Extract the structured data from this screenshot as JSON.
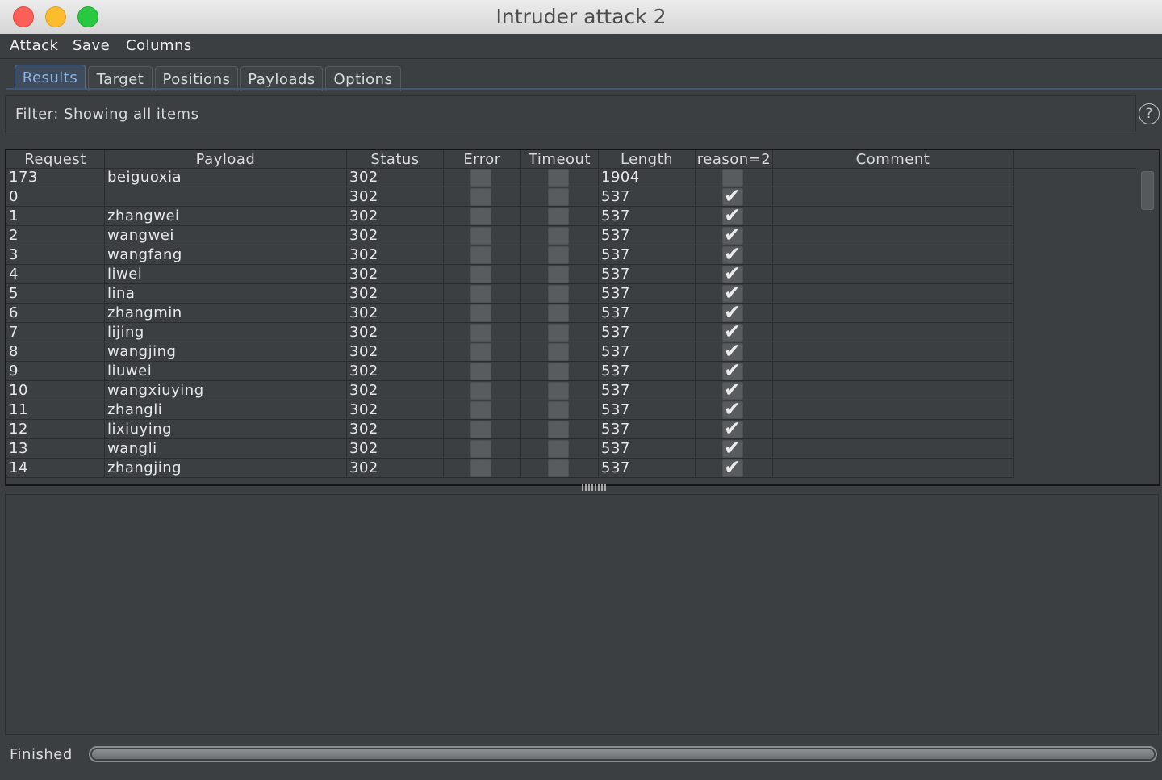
{
  "window": {
    "title": "Intruder attack 2"
  },
  "menu": [
    "Attack",
    "Save",
    "Columns"
  ],
  "tabs": [
    {
      "label": "Results",
      "active": true
    },
    {
      "label": "Target",
      "active": false
    },
    {
      "label": "Positions",
      "active": false
    },
    {
      "label": "Payloads",
      "active": false
    },
    {
      "label": "Options",
      "active": false
    }
  ],
  "filter": {
    "text": "Filter: Showing all items"
  },
  "help_icon_glyph": "?",
  "table": {
    "columns": [
      "Request",
      "Payload",
      "Status",
      "Error",
      "Timeout",
      "Length",
      "reason=2",
      "Comment"
    ],
    "rows": [
      {
        "request": "173",
        "payload": "beiguoxia",
        "status": "302",
        "error": false,
        "timeout": false,
        "length": "1904",
        "reason": false,
        "comment": ""
      },
      {
        "request": "0",
        "payload": "",
        "status": "302",
        "error": false,
        "timeout": false,
        "length": "537",
        "reason": true,
        "comment": ""
      },
      {
        "request": "1",
        "payload": "zhangwei",
        "status": "302",
        "error": false,
        "timeout": false,
        "length": "537",
        "reason": true,
        "comment": ""
      },
      {
        "request": "2",
        "payload": "wangwei",
        "status": "302",
        "error": false,
        "timeout": false,
        "length": "537",
        "reason": true,
        "comment": ""
      },
      {
        "request": "3",
        "payload": "wangfang",
        "status": "302",
        "error": false,
        "timeout": false,
        "length": "537",
        "reason": true,
        "comment": ""
      },
      {
        "request": "4",
        "payload": "liwei",
        "status": "302",
        "error": false,
        "timeout": false,
        "length": "537",
        "reason": true,
        "comment": ""
      },
      {
        "request": "5",
        "payload": "lina",
        "status": "302",
        "error": false,
        "timeout": false,
        "length": "537",
        "reason": true,
        "comment": ""
      },
      {
        "request": "6",
        "payload": "zhangmin",
        "status": "302",
        "error": false,
        "timeout": false,
        "length": "537",
        "reason": true,
        "comment": ""
      },
      {
        "request": "7",
        "payload": "lijing",
        "status": "302",
        "error": false,
        "timeout": false,
        "length": "537",
        "reason": true,
        "comment": ""
      },
      {
        "request": "8",
        "payload": "wangjing",
        "status": "302",
        "error": false,
        "timeout": false,
        "length": "537",
        "reason": true,
        "comment": ""
      },
      {
        "request": "9",
        "payload": "liuwei",
        "status": "302",
        "error": false,
        "timeout": false,
        "length": "537",
        "reason": true,
        "comment": ""
      },
      {
        "request": "10",
        "payload": "wangxiuying",
        "status": "302",
        "error": false,
        "timeout": false,
        "length": "537",
        "reason": true,
        "comment": ""
      },
      {
        "request": "11",
        "payload": "zhangli",
        "status": "302",
        "error": false,
        "timeout": false,
        "length": "537",
        "reason": true,
        "comment": ""
      },
      {
        "request": "12",
        "payload": "lixiuying",
        "status": "302",
        "error": false,
        "timeout": false,
        "length": "537",
        "reason": true,
        "comment": ""
      },
      {
        "request": "13",
        "payload": "wangli",
        "status": "302",
        "error": false,
        "timeout": false,
        "length": "537",
        "reason": true,
        "comment": ""
      },
      {
        "request": "14",
        "payload": "zhangjing",
        "status": "302",
        "error": false,
        "timeout": false,
        "length": "537",
        "reason": true,
        "comment": ""
      }
    ]
  },
  "status": {
    "text": "Finished",
    "progress": 1.0
  },
  "colors": {
    "active_tab_text": "#8fb3e3",
    "background": "#3b3f42"
  }
}
